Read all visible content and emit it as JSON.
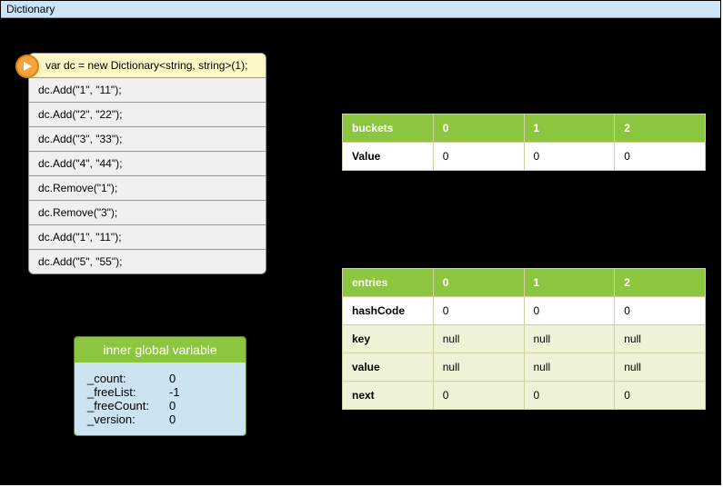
{
  "window": {
    "title": "Dictionary"
  },
  "code": {
    "lines": [
      "var dc = new Dictionary<string, string>(1);",
      "dc.Add(\"1\", \"11\");",
      "dc.Add(\"2\", \"22\");",
      "dc.Add(\"3\", \"33\");",
      " dc.Add(\"4\", \"44\");",
      "dc.Remove(\"1\");",
      "dc.Remove(\"3\");",
      "dc.Add(\"1\", \"11\");",
      " dc.Add(\"5\", \"55\");"
    ]
  },
  "globals": {
    "title": "inner global variable",
    "items": [
      {
        "label": "_count:",
        "value": "0"
      },
      {
        "label": "_freeList:",
        "value": "-1"
      },
      {
        "label": "_freeCount:",
        "value": "0"
      },
      {
        "label": "_version:",
        "value": "0"
      }
    ]
  },
  "buckets": {
    "header": "buckets",
    "cols": [
      "0",
      "1",
      "2"
    ],
    "rows": [
      {
        "label": "Value",
        "cells": [
          "0",
          "0",
          "0"
        ]
      }
    ]
  },
  "entries": {
    "header": "entries",
    "cols": [
      "0",
      "1",
      "2"
    ],
    "rows": [
      {
        "label": "hashCode",
        "cells": [
          "0",
          "0",
          "0"
        ],
        "alt": false
      },
      {
        "label": "key",
        "cells": [
          "null",
          "null",
          "null"
        ],
        "alt": true
      },
      {
        "label": "value",
        "cells": [
          "null",
          "null",
          "null"
        ],
        "alt": true
      },
      {
        "label": "next",
        "cells": [
          "0",
          "0",
          "0"
        ],
        "alt": true
      }
    ]
  }
}
